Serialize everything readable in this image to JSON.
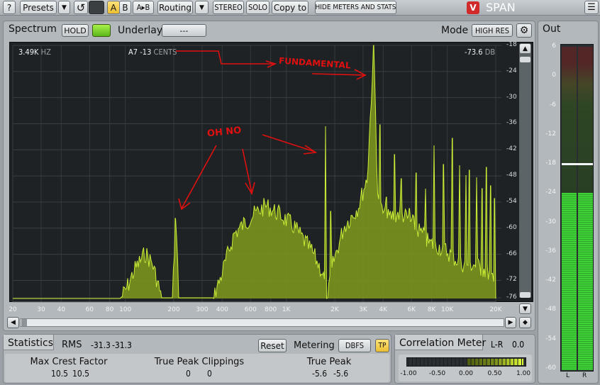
{
  "toolbar": {
    "help": "?",
    "presets": "Presets",
    "dropdown_arrow": "▼",
    "undo_icon": "↺",
    "a": "A",
    "b": "B",
    "ab": "A▸B",
    "routing": "Routing",
    "stereo": "STEREO",
    "solo": "SOLO",
    "copy_to": "Copy to",
    "hide": "HIDE METERS AND STATS",
    "app_name": "SPAN",
    "menu_icon": "☰"
  },
  "spectrum": {
    "title": "Spectrum",
    "hold": "HOLD",
    "underlay_label": "Underlay",
    "underlay_value": "---",
    "mode_label": "Mode",
    "mode_value": "HIGH RES",
    "readout_freq": "3.49K",
    "readout_freq_unit": "HZ",
    "readout_note": "A7",
    "readout_cents": "-13",
    "readout_cents_unit": "CENTS",
    "readout_db": "-73.6",
    "readout_db_unit": "DB",
    "y_ticks": [
      "-18",
      "-24",
      "-30",
      "-36",
      "-42",
      "-48",
      "-54",
      "-60",
      "-66",
      "-72",
      "-76"
    ],
    "x_ticks": [
      "20",
      "30",
      "40",
      "60",
      "80",
      "100",
      "200",
      "300",
      "400",
      "600",
      "800",
      "1K",
      "2K",
      "3K",
      "4K",
      "6K",
      "8K",
      "10K",
      "20K"
    ],
    "annotations": {
      "fundamental": "FUNDAMENTAL",
      "oh_no": "OH NO"
    },
    "colors": {
      "fill": "#7f9a1c",
      "line": "#c9ee37",
      "bg": "#1c2022"
    }
  },
  "out": {
    "title": "Out",
    "ticks": [
      "6",
      "0",
      "-6",
      "-12",
      "-18",
      "-24",
      "-30",
      "-36",
      "-42",
      "-48",
      "-54",
      "-60"
    ],
    "left": "L",
    "right": "R",
    "level_db": -24,
    "peak_hold_db": -18
  },
  "statistics": {
    "title": "Statistics",
    "rms_label": "RMS",
    "rms_l": "-31.3",
    "rms_r": "-31.3",
    "reset": "Reset",
    "metering_label": "Metering",
    "metering_value": "DBFS",
    "tp": "TP",
    "max_crest_label": "Max Crest Factor",
    "max_crest_l": "10.5",
    "max_crest_r": "10.5",
    "clip_label": "True Peak Clippings",
    "clip_l": "0",
    "clip_r": "0",
    "true_peak_label": "True Peak",
    "true_peak_l": "-5.6",
    "true_peak_r": "-5.6"
  },
  "correlation": {
    "title": "Correlation Meter",
    "mode": "L-R",
    "value": "0.0",
    "ticks": [
      "-1.00",
      "-0.50",
      "0.00",
      "0.50",
      "1.00"
    ]
  }
}
